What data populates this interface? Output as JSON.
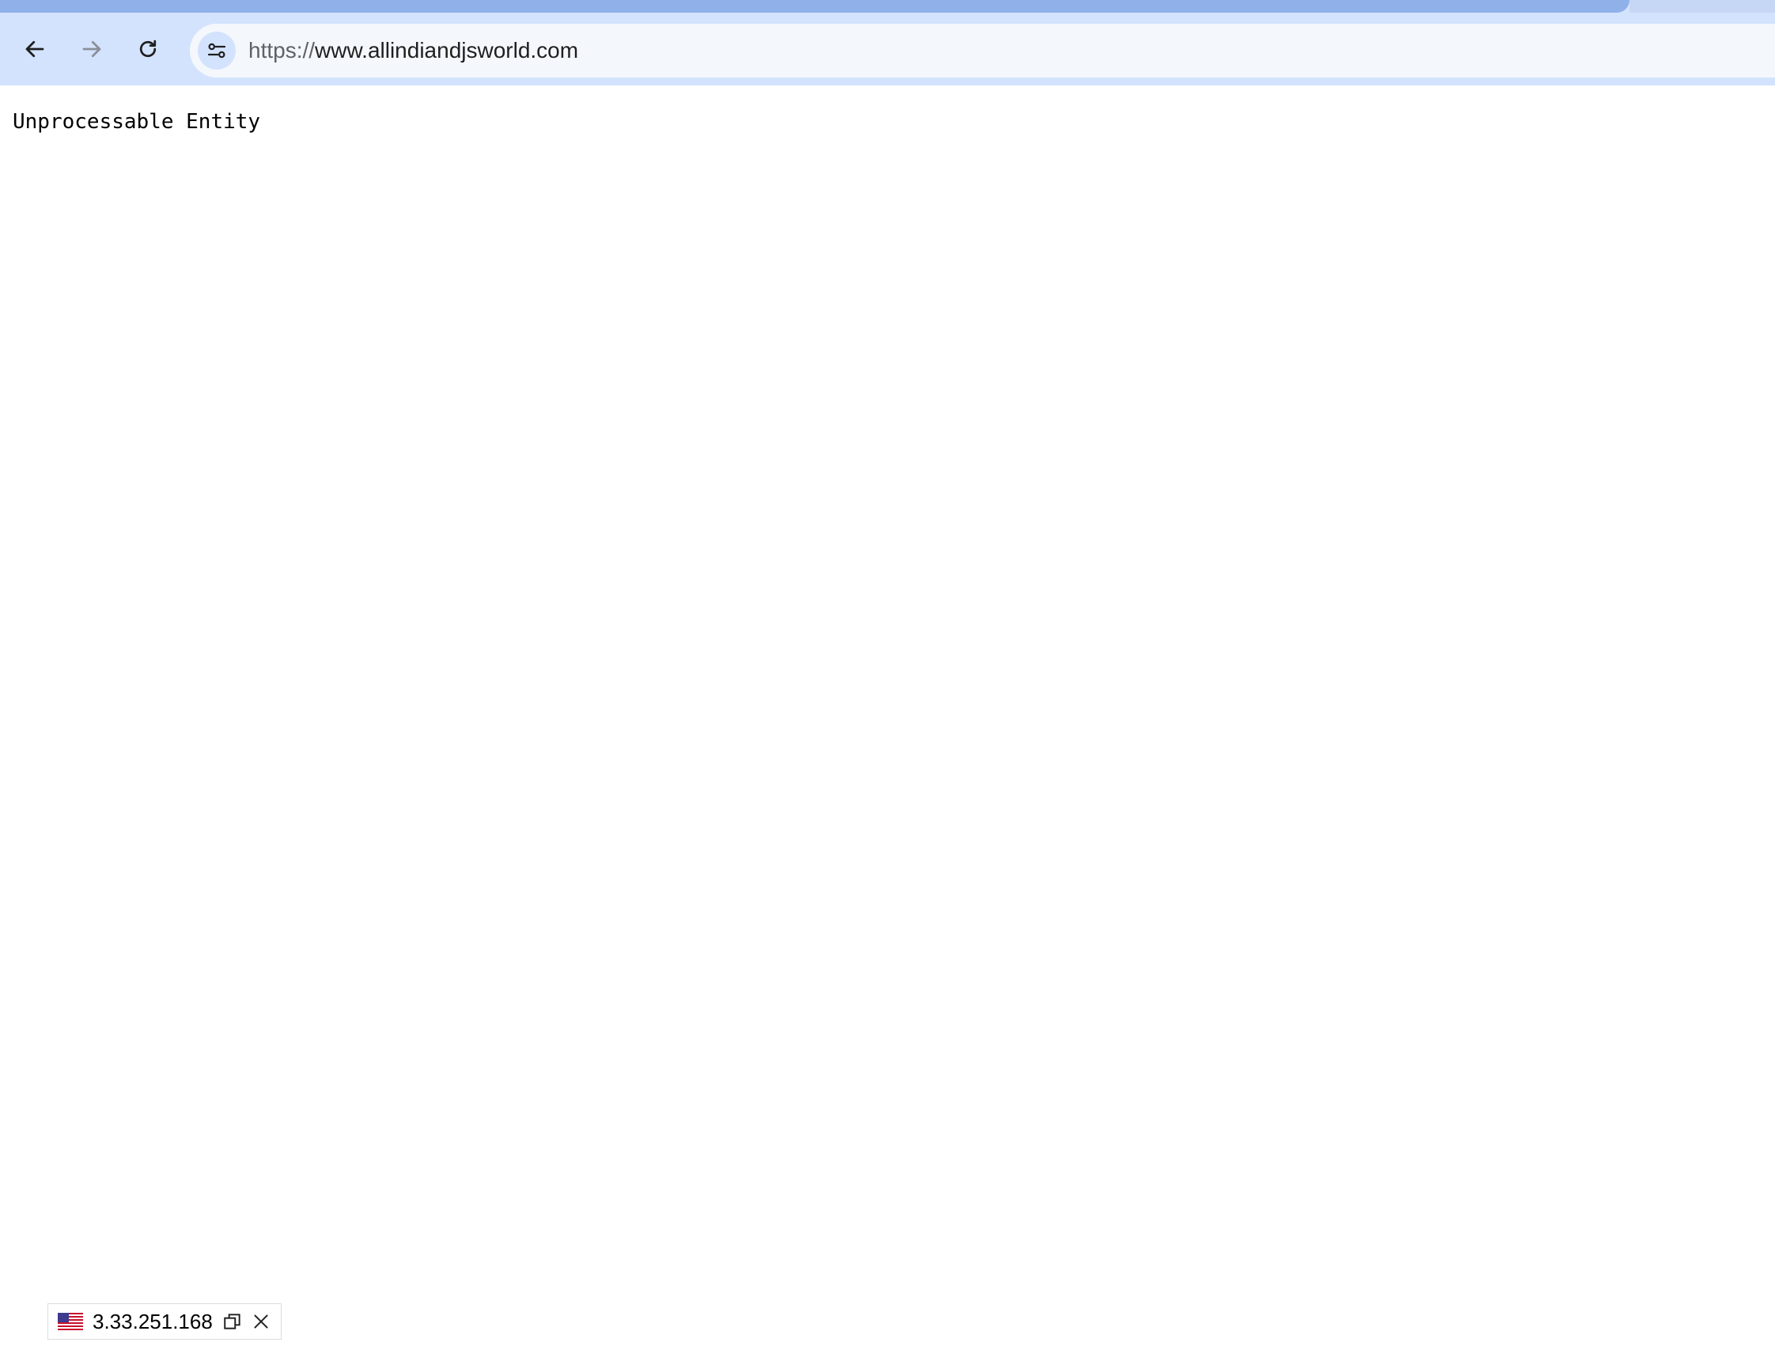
{
  "browser": {
    "url_scheme": "https://",
    "url_host": "www.allindiandjsworld.com",
    "back_icon": "arrow-left-icon",
    "forward_icon": "arrow-right-icon",
    "reload_icon": "reload-icon",
    "site_info_icon": "tune-icon"
  },
  "page": {
    "error_message": "Unprocessable Entity"
  },
  "ip_widget": {
    "flag_icon": "us-flag-icon",
    "ip_address": "3.33.251.168",
    "copy_icon": "copy-icon",
    "close_icon": "close-icon"
  },
  "colors": {
    "chrome_background": "#d3e3fd",
    "omnibox_background": "#f4f7fc",
    "page_background": "#ffffff"
  }
}
